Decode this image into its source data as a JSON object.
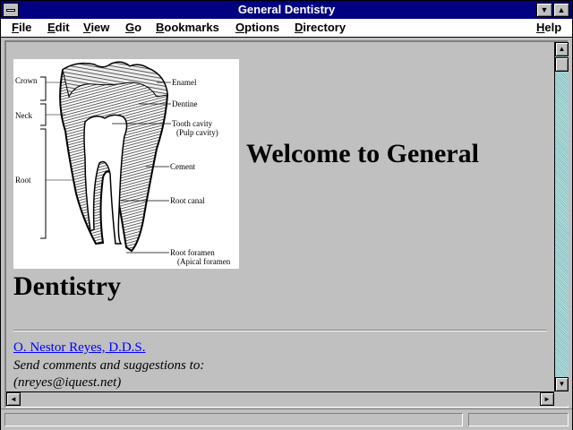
{
  "window": {
    "title": "General Dentistry",
    "minimize_glyph": "▼",
    "maximize_glyph": "▲"
  },
  "menu": {
    "items": [
      {
        "label": "File",
        "mnemonic": "F",
        "rest": "ile"
      },
      {
        "label": "Edit",
        "mnemonic": "E",
        "rest": "dit"
      },
      {
        "label": "View",
        "mnemonic": "V",
        "rest": "iew"
      },
      {
        "label": "Go",
        "mnemonic": "G",
        "rest": "o"
      },
      {
        "label": "Bookmarks",
        "mnemonic": "B",
        "rest": "ookmarks"
      },
      {
        "label": "Options",
        "mnemonic": "O",
        "rest": "ptions"
      },
      {
        "label": "Directory",
        "mnemonic": "D",
        "rest": "irectory"
      },
      {
        "label": "Help",
        "mnemonic": "H",
        "rest": "elp"
      }
    ]
  },
  "image": {
    "labels": {
      "crown": "Crown",
      "neck": "Neck",
      "root": "Root",
      "enamel": "Enamel",
      "dentine": "Dentine",
      "tooth_cavity": "Tooth cavity",
      "pulp_cavity": "(Pulp cavity)",
      "cement": "Cement",
      "root_canal": "Root canal",
      "root_foramen": "Root foramen",
      "apical_foramen": "(Apical foramen"
    }
  },
  "page": {
    "heading_line1": "Welcome to General",
    "heading_line2": "Dentistry",
    "author_link": "O. Nestor Reyes, D.D.S.",
    "comments": "Send comments and suggestions to:",
    "email": "(nreyes@iquest.net)"
  },
  "scrollbar": {
    "up": "▲",
    "down": "▼",
    "left": "◄",
    "right": "►"
  },
  "status": {
    "text": ""
  }
}
